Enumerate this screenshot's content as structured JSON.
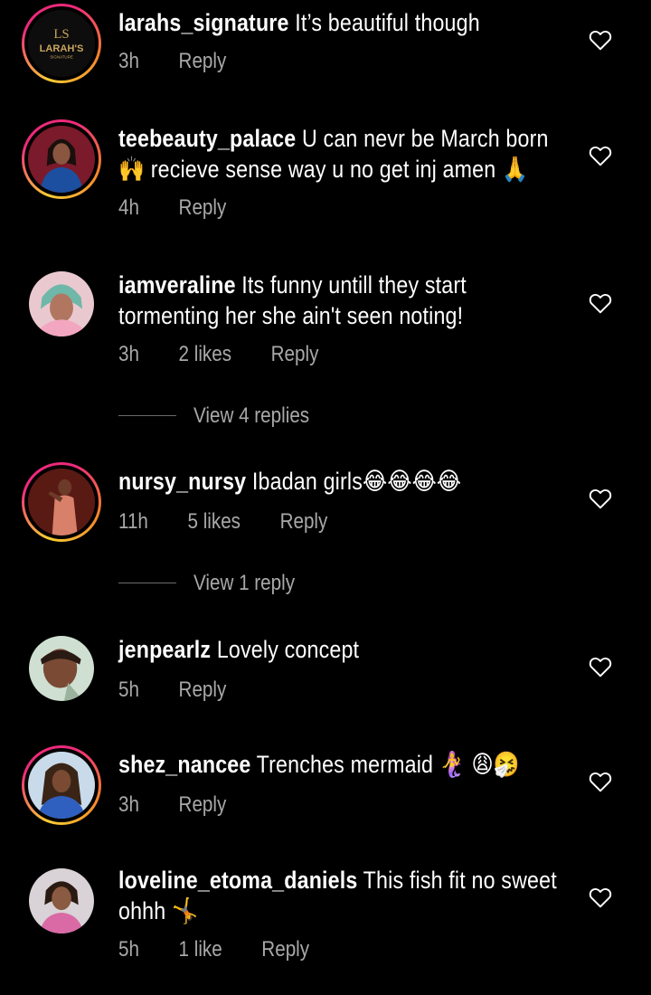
{
  "comments": [
    {
      "username": "larahs_signature",
      "text": "It’s beautiful though",
      "time": "3h",
      "likes": "",
      "reply": "Reply",
      "avatar_text": "LARAH'S",
      "avatar_subtext": "SIGNATURE",
      "avatar_monogram": "LS"
    },
    {
      "username": "teebeauty_palace",
      "text": "U can nevr be March born 🙌 recieve sense way u no get inj amen 🙏",
      "time": "4h",
      "likes": "",
      "reply": "Reply"
    },
    {
      "username": "iamveraline",
      "text": "Its funny untill they start tormenting her she ain't seen noting!",
      "time": "3h",
      "likes": "2 likes",
      "reply": "Reply",
      "view_replies": "View 4 replies"
    },
    {
      "username": "nursy_nursy",
      "text": "Ibadan girls😂😂😂😂",
      "time": "11h",
      "likes": "5 likes",
      "reply": "Reply",
      "view_replies": "View 1 reply"
    },
    {
      "username": "jenpearlz",
      "text": "Lovely concept",
      "time": "5h",
      "likes": "",
      "reply": "Reply"
    },
    {
      "username": "shez_nancee",
      "text": "Trenches mermaid 🧜‍♀️ 😩🤧",
      "time": "3h",
      "likes": "",
      "reply": "Reply"
    },
    {
      "username": "loveline_etoma_daniels",
      "text": "This fish fit no sweet ohhh 🤸",
      "time": "5h",
      "likes": "1 like",
      "reply": "Reply"
    }
  ],
  "icons": {
    "like": "heart-outline-icon"
  },
  "colors": {
    "background": "#000000",
    "text": "#ffffff",
    "meta": "#a8a8a8",
    "story_ring_start": "#f9ce34",
    "story_ring_end": "#ee2a7b"
  }
}
